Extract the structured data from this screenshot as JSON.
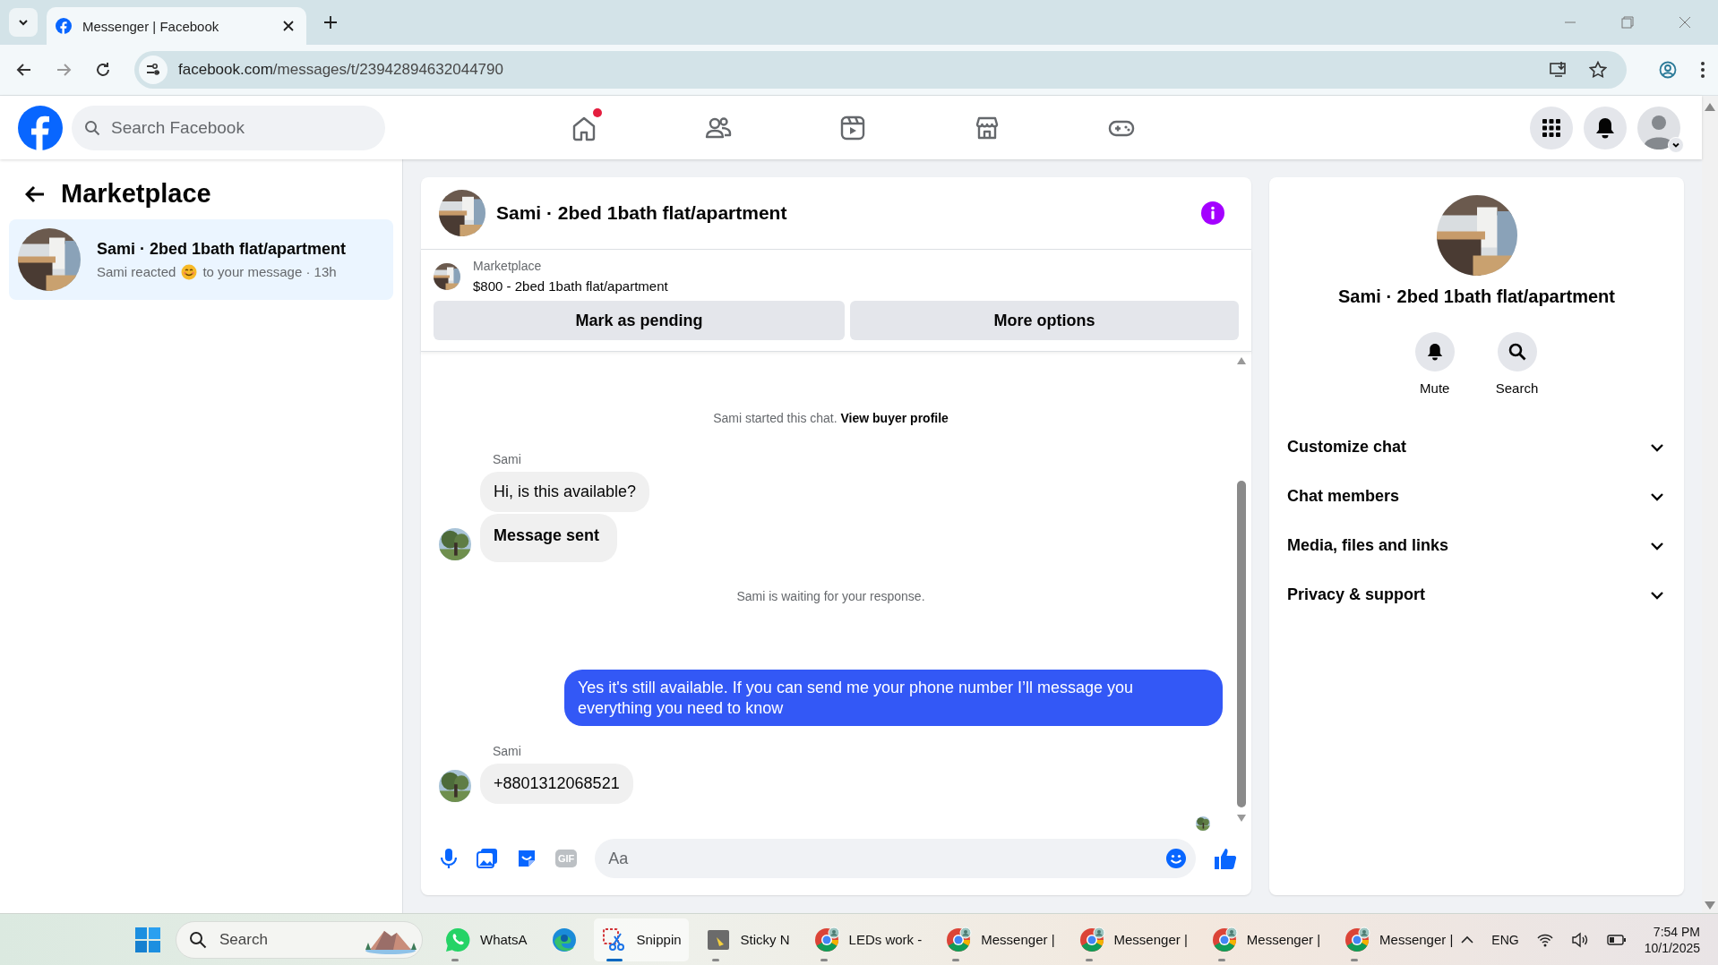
{
  "browser": {
    "tab_title": "Messenger | Facebook",
    "url_host": "facebook.com",
    "url_path": "/messages/t/23942894632044790"
  },
  "header": {
    "search_placeholder": "Search Facebook",
    "nav": [
      {
        "kind": "home",
        "notification": true
      },
      {
        "kind": "friends",
        "notification": false
      },
      {
        "kind": "video",
        "notification": false
      },
      {
        "kind": "marketplace",
        "notification": false
      },
      {
        "kind": "gaming",
        "notification": false
      }
    ]
  },
  "sidebar": {
    "title": "Marketplace",
    "conversations": [
      {
        "title": "Sami · 2bed 1bath flat/apartment",
        "preview_before": "Sami reacted",
        "preview_after": "to your message · 13h",
        "selected": true
      }
    ]
  },
  "chat": {
    "title": "Sami · 2bed 1bath flat/apartment",
    "listing": {
      "label": "Marketplace",
      "name": "$800 - 2bed 1bath flat/apartment"
    },
    "buttons": [
      "Mark as pending",
      "More options"
    ],
    "messages": [
      {
        "kind": "system",
        "text": "Sami started this chat.",
        "link": "View buyer profile"
      },
      {
        "kind": "incoming",
        "sender": "Sami",
        "bubbles": [
          {
            "text": "Hi, is this available?",
            "bold": false
          },
          {
            "text": "Message sent",
            "bold": true
          }
        ]
      },
      {
        "kind": "system",
        "text": "Sami is waiting for your response."
      },
      {
        "kind": "outgoing",
        "bubbles": [
          {
            "text": "Yes it's still available. If you can send me your phone number I’ll message you everything you need to know",
            "bold": false
          }
        ]
      },
      {
        "kind": "incoming",
        "sender": "Sami",
        "bubbles": [
          {
            "text": "+8801312068521",
            "bold": false
          }
        ]
      }
    ],
    "composer": {
      "gif": "GIF",
      "placeholder": "Aa"
    }
  },
  "details": {
    "title": "Sami · 2bed 1bath flat/apartment",
    "actions": [
      {
        "kind": "mute",
        "label": "Mute"
      },
      {
        "kind": "search",
        "label": "Search"
      }
    ],
    "sections": [
      "Customize chat",
      "Chat members",
      "Media, files and links",
      "Privacy & support"
    ]
  },
  "taskbar": {
    "search": "Search",
    "apps": [
      {
        "kind": "whatsapp",
        "label": "WhatsA",
        "running": true,
        "selected": false
      },
      {
        "kind": "edge",
        "running": false,
        "selected": false
      },
      {
        "kind": "snipping",
        "label": "Snippin",
        "running": true,
        "selected": true
      },
      {
        "kind": "sticky",
        "label": "Sticky N",
        "running": true,
        "selected": false
      },
      {
        "kind": "chrome",
        "label": "LEDs work -",
        "running": true,
        "selected": false
      },
      {
        "kind": "chrome",
        "label": "Messenger |",
        "running": true,
        "selected": false
      },
      {
        "kind": "chrome",
        "label": "Messenger |",
        "running": true,
        "selected": false
      },
      {
        "kind": "chrome",
        "label": "Messenger |",
        "running": true,
        "selected": false
      },
      {
        "kind": "chrome",
        "label": "Messenger |",
        "running": true,
        "selected": false
      }
    ],
    "language": "ENG",
    "time": "7:54 PM",
    "date": "10/1/2025"
  }
}
